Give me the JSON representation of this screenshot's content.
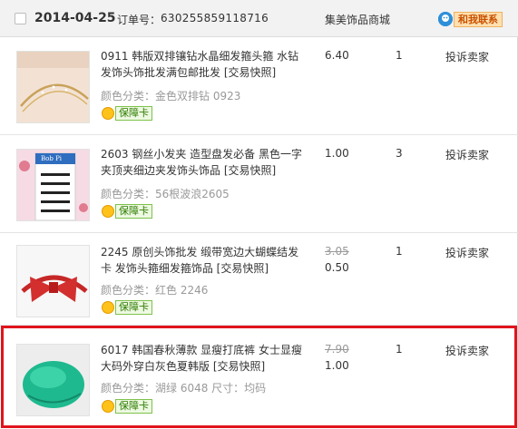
{
  "header": {
    "date": "2014-04-25",
    "order_label": "订单号：",
    "order_number": "630255859118716",
    "shop_name": "集美饰品商城",
    "contact_label": "和我联系",
    "contact_icon": "chat-bubble-icon"
  },
  "snapshot_label": "[交易快照]",
  "badge_label": "保障卡",
  "items": [
    {
      "title": "0911 韩版双排镶钻水晶细发箍头箍 水钻发饰头饰批发满包邮批发",
      "attr": "颜色分类：金色双排钻 0923",
      "price": "6.40",
      "quantity": "1",
      "action": "投诉卖家"
    },
    {
      "title": "2603 钢丝小发夹 造型盘发必备 黑色一字夹顶夹细边夹发饰头饰品",
      "attr": "颜色分类：56根波浪2605",
      "price": "1.00",
      "quantity": "3",
      "action": "投诉卖家",
      "card_text": "Bob Pi"
    },
    {
      "title": "2245 原创头饰批发 缎带宽边大蝴蝶结发卡 发饰头箍细发箍饰品",
      "attr": "颜色分类：红色 2246",
      "original_price": "3.05",
      "price": "0.50",
      "quantity": "1",
      "action": "投诉卖家"
    },
    {
      "title": "6017 韩国春秋薄款 显瘦打底裤 女士显瘦大码外穿白灰色夏韩版",
      "attr": "颜色分类：湖绿 6048 尺寸：均码",
      "original_price": "7.90",
      "price": "1.00",
      "quantity": "1",
      "action": "投诉卖家"
    }
  ],
  "colors": {
    "highlight": "#e0141c",
    "header_bg": "#f2f2f2",
    "badge_green": "#2e7d00"
  }
}
